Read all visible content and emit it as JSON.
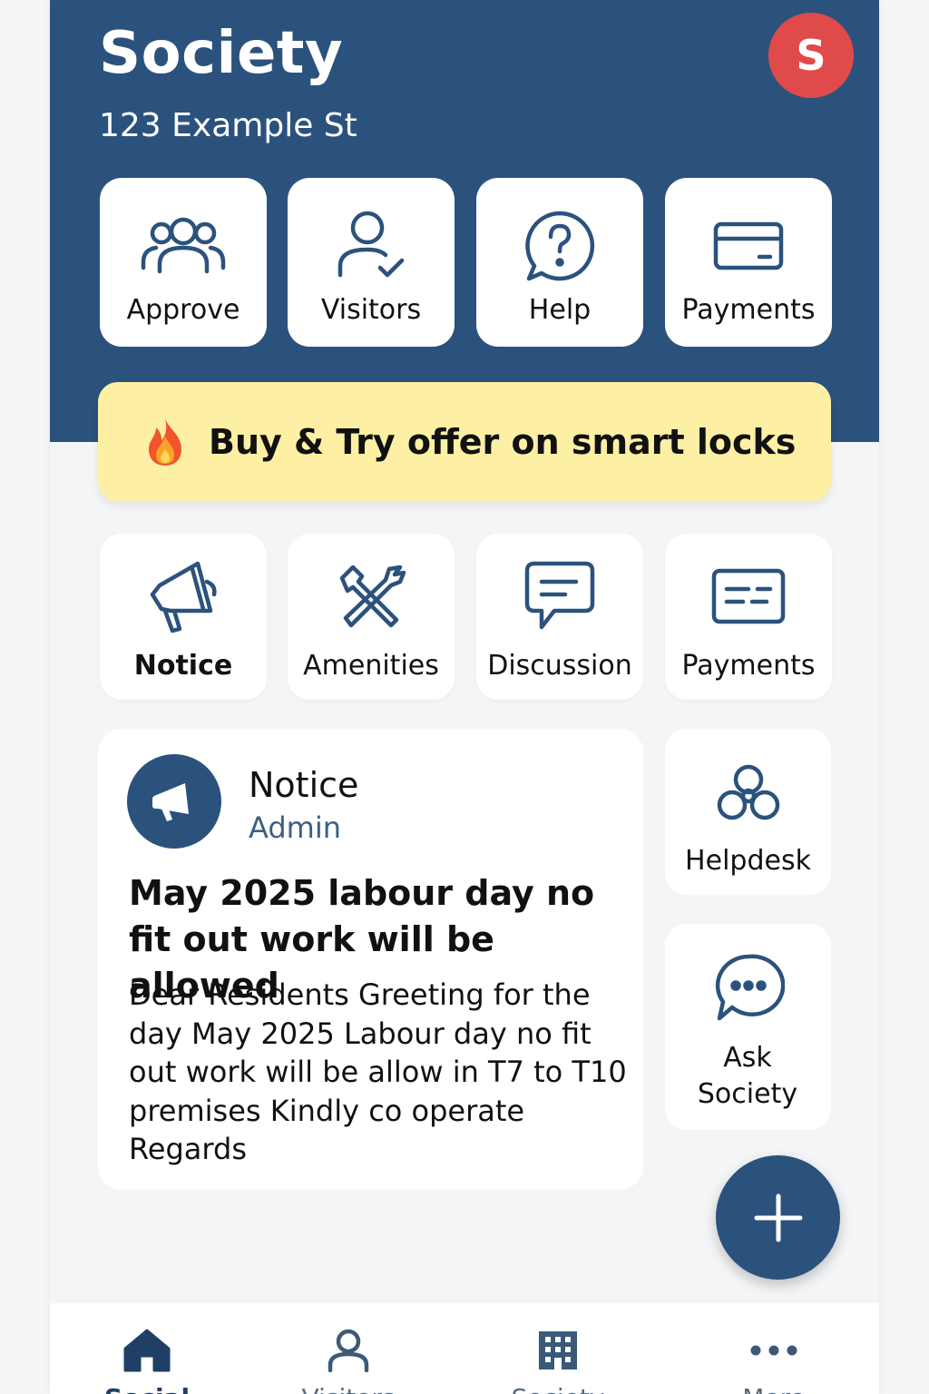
{
  "header": {
    "title": "Society",
    "address": "123 Example St",
    "avatar_initial": "S",
    "background_color": "#2b527d"
  },
  "quick_actions": [
    {
      "label": "Approve",
      "icon": "users-group-icon"
    },
    {
      "label": "Visitors",
      "icon": "visitor-check-icon"
    },
    {
      "label": "Help",
      "icon": "help-chat-icon"
    },
    {
      "label": "Payments",
      "icon": "credit-card-icon"
    }
  ],
  "banner": {
    "icon": "fire-icon",
    "text": "Buy & Try offer on smart locks",
    "background_color": "#fdf0a4"
  },
  "features": [
    {
      "label": "Notice",
      "icon": "megaphone-icon",
      "selected": true
    },
    {
      "label": "Amenities",
      "icon": "tools-icon"
    },
    {
      "label": "Discussion",
      "icon": "chat-bubble-icon"
    },
    {
      "label": "Payments",
      "icon": "bill-card-icon"
    }
  ],
  "notice_card": {
    "title": "Notice",
    "author": "Admin",
    "headline": "May 2025 labour day no fit out work will be allowed",
    "body": "Dear Residents Greeting for the day May 2025 Labour day no fit out work will be allow in T7 to T10 premises Kindly co operate Regards"
  },
  "side_tiles": [
    {
      "label": "Helpdesk",
      "icon": "helpdesk-flower-icon"
    },
    {
      "label": "Ask Society",
      "icon": "ask-chat-icon"
    }
  ],
  "fab": {
    "icon": "plus-icon"
  },
  "bottom_nav": [
    {
      "label": "Social",
      "icon": "home-icon",
      "active": true
    },
    {
      "label": "Visitors",
      "icon": "person-icon"
    },
    {
      "label": "Society",
      "icon": "building-icon"
    },
    {
      "label": "More",
      "icon": "more-dots-icon"
    }
  ],
  "colors": {
    "primary": "#2b527d",
    "avatar": "#e04a4a",
    "background": "#f4f5f7"
  }
}
